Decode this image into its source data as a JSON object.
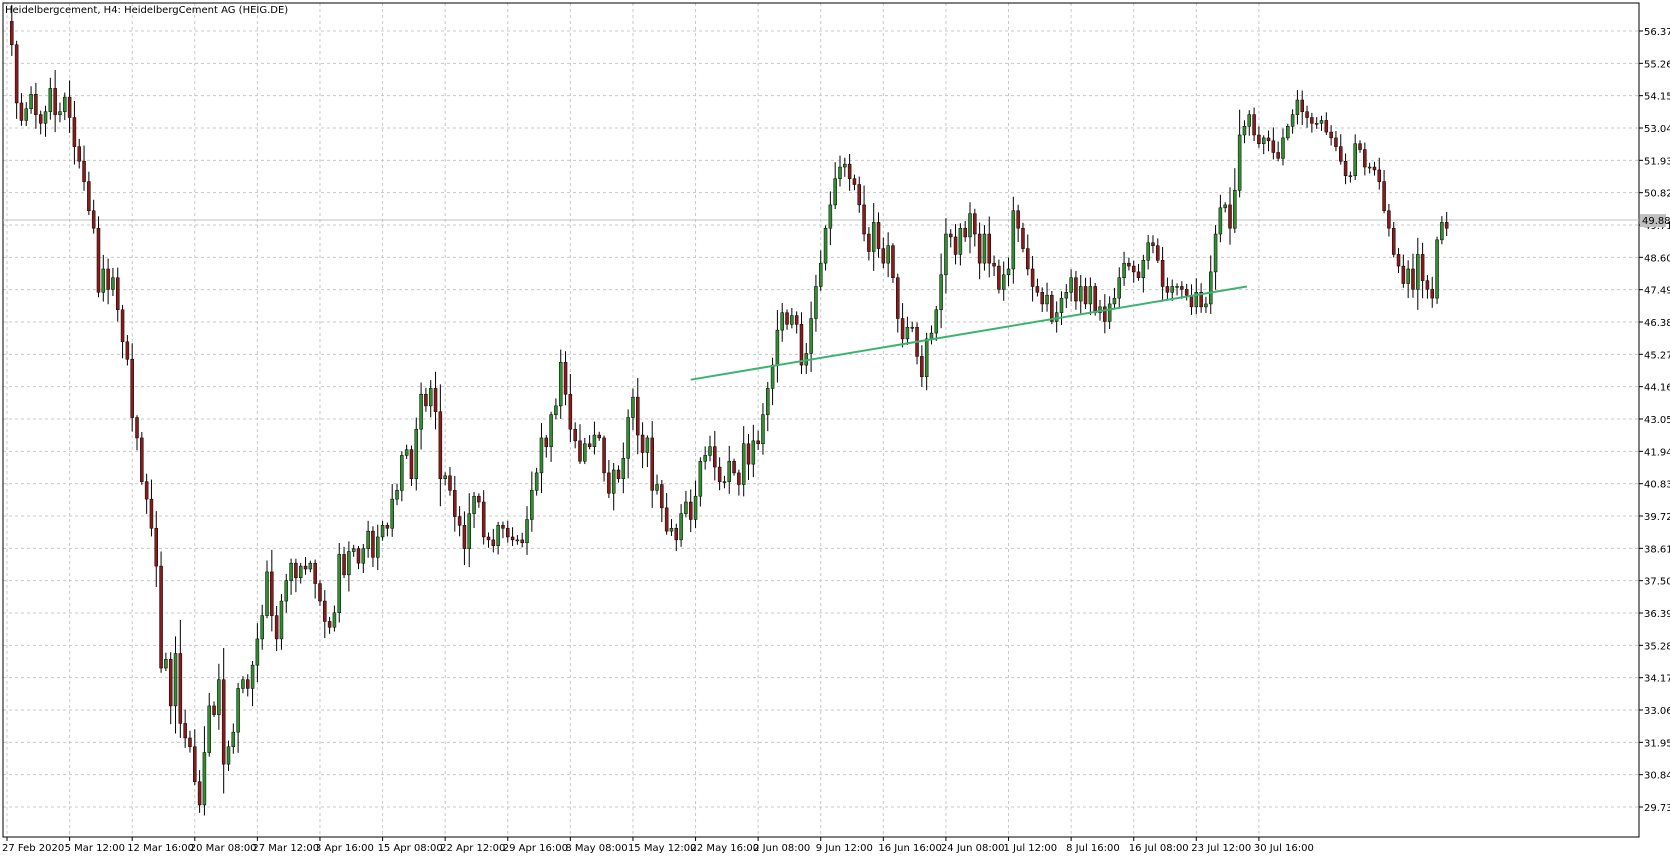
{
  "window": {
    "title": "Heidelbergcement, H4:  HeidelbergCement AG (HEIG.DE)"
  },
  "price_marker": {
    "value": "49.88"
  },
  "colors": {
    "bull": "#2f8f2f",
    "bear": "#8b1a1a",
    "wick": "#000000",
    "grid": "#c8c8c8",
    "trendline": "#3cb371",
    "price_line": "#c0c0c0",
    "price_tag_bg": "#c0c0c0"
  },
  "chart_data": {
    "type": "candlestick",
    "symbol": "HEIG.DE",
    "timeframe": "H4",
    "ylim": [
      29.1,
      57.2
    ],
    "y_ticks": [
      "56.37",
      "55.26",
      "54.15",
      "53.04",
      "51.93",
      "50.82",
      "49.71",
      "48.60",
      "47.49",
      "46.38",
      "45.27",
      "44.16",
      "43.05",
      "41.94",
      "40.83",
      "39.72",
      "38.61",
      "37.50",
      "36.39",
      "35.28",
      "34.17",
      "33.06",
      "31.95",
      "30.84",
      "29.73"
    ],
    "x_ticks": [
      {
        "label": "27 Feb 2020",
        "bar": 0
      },
      {
        "label": "5 Mar 12:00",
        "bar": 13
      },
      {
        "label": "12 Mar 16:00",
        "bar": 26
      },
      {
        "label": "20 Mar 08:00",
        "bar": 39
      },
      {
        "label": "27 Mar 12:00",
        "bar": 52
      },
      {
        "label": "3 Apr 16:00",
        "bar": 65
      },
      {
        "label": "15 Apr 08:00",
        "bar": 78
      },
      {
        "label": "22 Apr 12:00",
        "bar": 91
      },
      {
        "label": "29 Apr 16:00",
        "bar": 104
      },
      {
        "label": "8 May 08:00",
        "bar": 117
      },
      {
        "label": "15 May 12:00",
        "bar": 130
      },
      {
        "label": "22 May 16:00",
        "bar": 143
      },
      {
        "label": "2 Jun 08:00",
        "bar": 156
      },
      {
        "label": "9 Jun 12:00",
        "bar": 169
      },
      {
        "label": "16 Jun 16:00",
        "bar": 182
      },
      {
        "label": "24 Jun 08:00",
        "bar": 195
      },
      {
        "label": "1 Jul 12:00",
        "bar": 208
      },
      {
        "label": "8 Jul 16:00",
        "bar": 221
      },
      {
        "label": "16 Jul 08:00",
        "bar": 234
      },
      {
        "label": "23 Jul 12:00",
        "bar": 247
      },
      {
        "label": "30 Jul 16:00",
        "bar": 260
      }
    ],
    "closes": [
      56.7,
      55.9,
      53.9,
      53.3,
      53.7,
      54.2,
      53.5,
      53.2,
      53.6,
      54.4,
      53.5,
      53.6,
      54.1,
      53.4,
      52.4,
      51.9,
      51.2,
      50.2,
      49.6,
      47.4,
      48.2,
      47.5,
      47.9,
      46.8,
      45.7,
      45.1,
      43.1,
      42.4,
      40.9,
      40.3,
      39.3,
      38.0,
      34.5,
      34.8,
      33.2,
      35.0,
      32.6,
      32.1,
      31.8,
      30.6,
      29.8,
      31.6,
      33.2,
      32.9,
      34.1,
      31.2,
      31.8,
      32.3,
      33.8,
      34.1,
      33.8,
      34.6,
      35.5,
      36.3,
      37.8,
      36.3,
      35.5,
      36.8,
      37.5,
      38.1,
      37.6,
      38.0,
      37.9,
      38.1,
      37.4,
      36.8,
      36.1,
      35.9,
      36.4,
      38.4,
      37.7,
      38.5,
      38.6,
      38.1,
      38.6,
      39.2,
      38.3,
      39.0,
      39.4,
      39.3,
      40.3,
      40.6,
      41.8,
      42.0,
      41.0,
      42.7,
      43.9,
      43.5,
      44.1,
      43.3,
      41.0,
      41.1,
      40.6,
      39.7,
      39.4,
      38.6,
      39.8,
      40.4,
      40.2,
      39.0,
      38.9,
      38.7,
      39.4,
      39.3,
      39.0,
      38.9,
      38.9,
      38.8,
      39.6,
      40.6,
      41.2,
      42.4,
      42.1,
      43.2,
      43.5,
      45.0,
      43.9,
      42.7,
      42.3,
      41.6,
      42.2,
      42.1,
      42.5,
      42.4,
      41.2,
      40.5,
      41.3,
      41.0,
      41.7,
      43.1,
      43.8,
      42.5,
      41.9,
      42.4,
      40.6,
      40.8,
      40.0,
      39.2,
      39.3,
      38.9,
      39.8,
      40.2,
      39.6,
      40.4,
      41.6,
      41.8,
      42.1,
      41.4,
      40.9,
      40.9,
      41.6,
      41.2,
      40.8,
      42.2,
      41.5,
      42.3,
      42.2,
      43.2,
      44.1,
      44.9,
      46.1,
      46.7,
      46.3,
      46.6,
      46.3,
      44.9,
      45.3,
      46.5,
      47.6,
      48.4,
      49.6,
      50.4,
      51.3,
      51.7,
      51.8,
      51.3,
      51.1,
      50.4,
      49.4,
      48.8,
      49.8,
      48.9,
      48.4,
      49.0,
      47.9,
      46.5,
      45.8,
      46.2,
      46.2,
      45.2,
      44.5,
      45.8,
      46.0,
      46.8,
      48.0,
      49.4,
      49.3,
      48.7,
      49.6,
      49.3,
      50.1,
      49.4,
      48.4,
      49.4,
      48.4,
      48.3,
      47.5,
      48.0,
      48.2,
      50.2,
      49.6,
      48.9,
      48.2,
      47.6,
      47.4,
      47.0,
      47.3,
      46.4,
      46.7,
      47.2,
      47.4,
      47.9,
      47.1,
      47.6,
      47.0,
      47.6,
      46.7,
      46.9,
      46.4,
      47.0,
      47.2,
      47.9,
      48.4,
      48.3,
      48.1,
      47.9,
      48.5,
      49.1,
      49.0,
      48.5,
      47.6,
      47.4,
      47.6,
      47.6,
      47.5,
      47.3,
      46.9,
      47.4,
      46.9,
      47.0,
      48.1,
      49.4,
      50.3,
      50.4,
      49.6,
      50.9,
      52.8,
      53.1,
      53.5,
      52.8,
      52.5,
      52.7,
      52.6,
      52.2,
      52.0,
      52.7,
      53.1,
      53.5,
      54.0,
      53.6,
      53.4,
      53.2,
      53.2,
      53.3,
      52.9,
      52.7,
      52.4,
      51.9,
      51.4,
      51.4,
      52.5,
      52.3,
      51.7,
      51.7,
      51.6,
      51.2,
      50.2,
      49.6,
      48.7,
      48.3,
      47.7,
      48.2,
      47.5,
      48.7,
      47.8,
      47.5,
      47.2,
      49.2,
      49.8,
      49.6
    ]
  },
  "trendline": {
    "from": {
      "bar": 142,
      "price": 44.4
    },
    "to": {
      "bar": 257.5,
      "price": 47.6
    }
  }
}
